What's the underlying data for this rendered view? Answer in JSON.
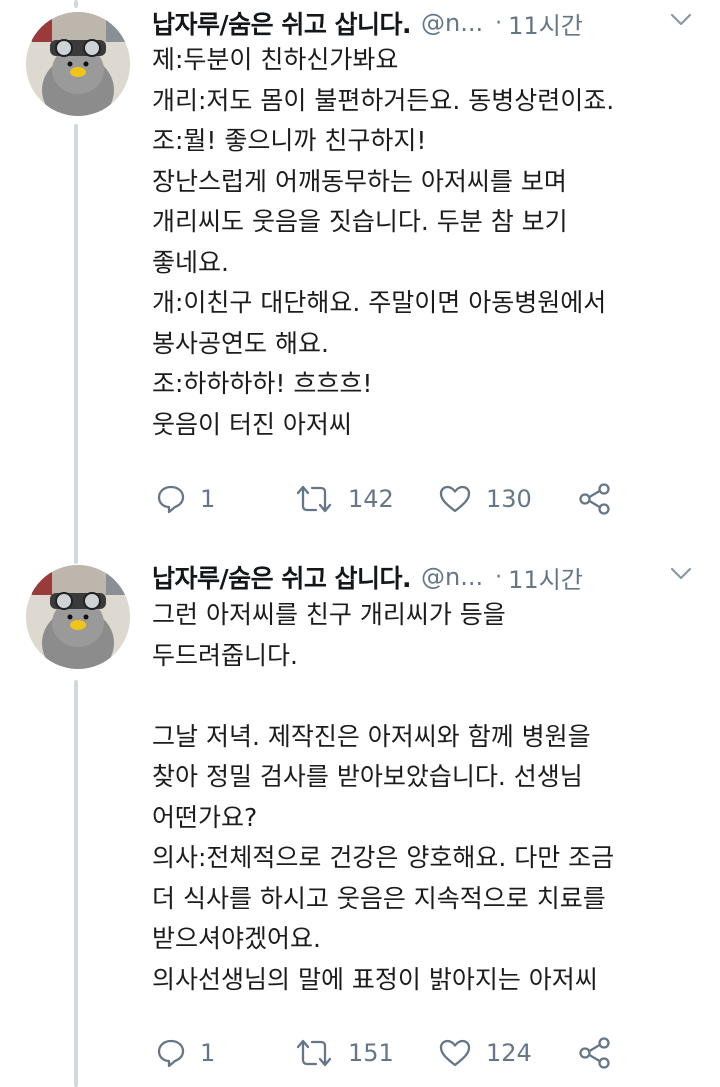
{
  "tweets": [
    {
      "user_name": "납자루/숨은 쉬고 삽니다.",
      "handle": "@n...",
      "separator": "·",
      "time": "11시간",
      "lines": [
        "제:두분이 친하신가봐요",
        "개리:저도 몸이 불편하거든요. 동병상련이죠.",
        "조:뭘! 좋으니까 친구하지!",
        "장난스럽게 어깨동무하는 아저씨를 보며",
        "개리씨도 웃음을 짓습니다. 두분 참 보기",
        "좋네요.",
        "개:이친구 대단해요. 주말이면 아동병원에서",
        "봉사공연도 해요.",
        "조:하하하하! 흐흐흐!",
        "웃음이 터진 아저씨"
      ],
      "reply_count": "1",
      "retweet_count": "142",
      "like_count": "130"
    },
    {
      "user_name": "납자루/숨은 쉬고 삽니다.",
      "handle": "@n...",
      "separator": "·",
      "time": "11시간",
      "lines": [
        "그런 아저씨를 친구 개리씨가 등을",
        "두드려줍니다.",
        "",
        "그날 저녁. 제작진은 아저씨와 함께 병원을",
        "찾아 정밀 검사를 받아보았습니다. 선생님",
        "어떤가요?",
        "의사:전체적으로 건강은 양호해요. 다만 조금",
        "더 식사를 하시고 웃음은 지속적으로 치료를",
        "받으셔야겠어요.",
        "의사선생님의 말에 표정이 밝아지는 아저씨"
      ],
      "reply_count": "1",
      "retweet_count": "151",
      "like_count": "124"
    }
  ],
  "icons": {
    "reply": "reply-icon",
    "retweet": "retweet-icon",
    "like": "heart-icon",
    "share": "share-icon",
    "menu": "chevron-down-icon"
  },
  "colors": {
    "muted": "#657786",
    "thread_line": "#cfd9de",
    "text": "#1c1c1c"
  }
}
